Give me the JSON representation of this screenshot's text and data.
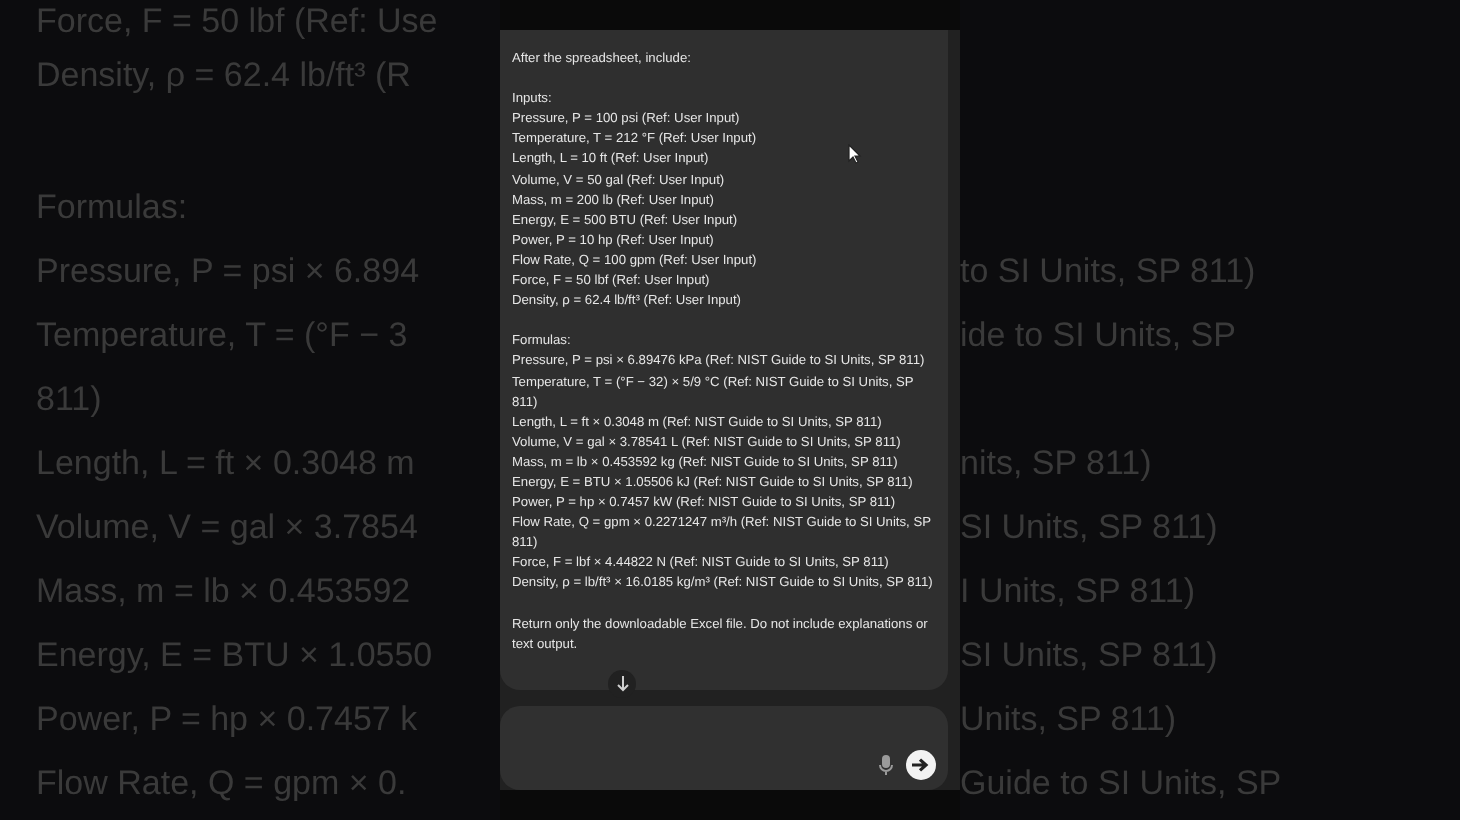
{
  "background_text": {
    "groups": [
      {
        "rows": [
          {
            "left": "Force, F = 50 lbf (Ref: Use"
          },
          {
            "left": "Density, ρ = 62.4 lb/ft³ (R"
          }
        ]
      },
      {
        "rows": [
          {
            "left": "Formulas:"
          },
          {
            "left": "Pressure, P = psi × 6.894",
            "right": "to SI Units, SP 811)"
          },
          {
            "left": "Temperature, T = (°F − 3",
            "right": "ide to SI Units, SP"
          },
          {
            "left": "811)"
          },
          {
            "left": "Length, L = ft × 0.3048 m",
            "right": "nits, SP 811)"
          },
          {
            "left": "Volume, V = gal × 3.7854",
            "right": "SI Units, SP 811)"
          },
          {
            "left": "Mass, m = lb × 0.453592",
            "right": "I Units, SP 811)"
          },
          {
            "left": "Energy, E = BTU × 1.0550",
            "right": "SI Units, SP 811)"
          },
          {
            "left": "Power, P = hp × 0.7457 k",
            "right": "Units, SP 811)"
          },
          {
            "left": "Flow Rate, Q = gpm × 0.",
            "right": "Guide to SI Units, SP"
          }
        ]
      }
    ]
  },
  "message": {
    "intro": "After the spreadsheet, include:",
    "sections": [
      {
        "heading": "Inputs:",
        "lines": [
          "Pressure, P = 100 psi (Ref: User Input)",
          "Temperature, T = 212 °F (Ref: User Input)",
          "Length, L = 10 ft (Ref: User Input)",
          "Volume, V = 50 gal (Ref: User Input)",
          "Mass, m = 200 lb (Ref: User Input)",
          "Energy, E = 500 BTU (Ref: User Input)",
          "Power, P = 10 hp (Ref: User Input)",
          "Flow Rate, Q = 100 gpm (Ref: User Input)",
          "Force, F = 50 lbf (Ref: User Input)",
          "Density, ρ = 62.4 lb/ft³ (Ref: User Input)"
        ]
      },
      {
        "heading": "Formulas:",
        "lines": [
          "Pressure, P = psi × 6.89476 kPa (Ref: NIST Guide to SI Units, SP 811)",
          "Temperature, T = (°F − 32) × 5/9 °C (Ref: NIST Guide to SI Units, SP 811)",
          "Length, L = ft × 0.3048 m (Ref: NIST Guide to SI Units, SP 811)",
          "Volume, V = gal × 3.78541 L (Ref: NIST Guide to SI Units, SP 811)",
          "Mass, m = lb × 0.453592 kg (Ref: NIST Guide to SI Units, SP 811)",
          "Energy, E = BTU × 1.05506 kJ (Ref: NIST Guide to SI Units, SP 811)",
          "Power, P = hp × 0.7457 kW (Ref: NIST Guide to SI Units, SP 811)",
          "Flow Rate, Q = gpm × 0.2271247 m³/h (Ref: NIST Guide to SI Units, SP 811)",
          "Force, F = lbf × 4.44822 N (Ref: NIST Guide to SI Units, SP 811)",
          "Density, ρ = lb/ft³ × 16.0185 kg/m³ (Ref: NIST Guide to SI Units, SP 811)"
        ]
      }
    ],
    "closing": "Return only the downloadable Excel file. Do not include explanations or text output."
  }
}
